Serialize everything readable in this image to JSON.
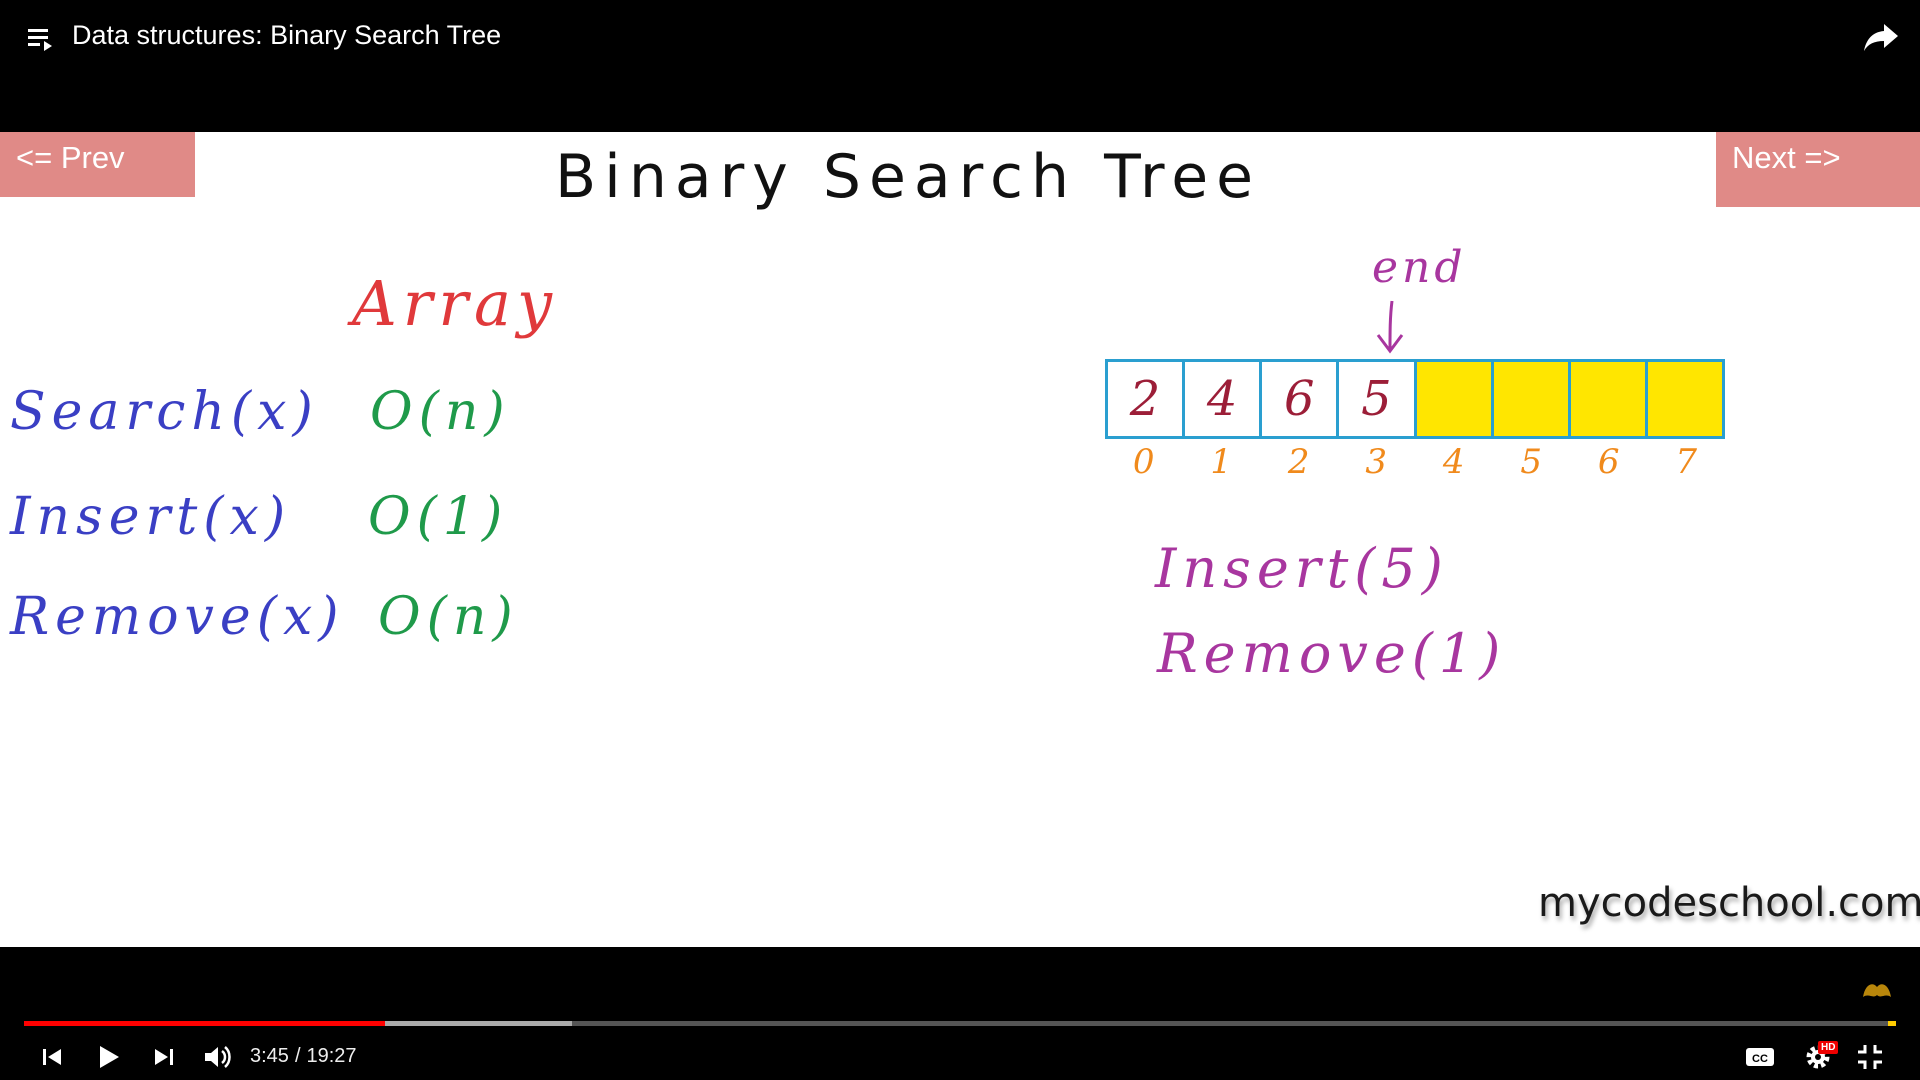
{
  "header": {
    "title": "Data structures: Binary Search Tree"
  },
  "slide": {
    "prev_label": "<= Prev",
    "next_label": "Next =>",
    "title": "Binary Search Tree",
    "array_heading": "Array",
    "operations": [
      {
        "label": "Search(x)",
        "cost": "O(n)"
      },
      {
        "label": "Insert(x)",
        "cost": "O(1)"
      },
      {
        "label": "Remove(x)",
        "cost": "O(n)"
      }
    ],
    "end_label": "end",
    "array_cells": [
      "2",
      "4",
      "6",
      "5",
      "",
      "",
      "",
      ""
    ],
    "array_indices": [
      "0",
      "1",
      "2",
      "3",
      "4",
      "5",
      "6",
      "7"
    ],
    "insert_example": "Insert(5)",
    "remove_example": "Remove(1)",
    "watermark": "mycodeschool.com",
    "colors": {
      "title": "#111111",
      "array_heading": "#e0393b",
      "operations": "#3a3fc4",
      "costs": "#1f9a4a",
      "examples": "#a8369f",
      "indices": "#f08a1c",
      "cell_values": "#9c1e38",
      "empty_cells": "#ffe600",
      "nav_buttons": "#e08a87"
    }
  },
  "controls": {
    "current_time": "3:45",
    "separator": "/",
    "duration": "19:27",
    "progress_played_fraction": 0.1928,
    "buffered_fraction": 0.2927,
    "icons": {
      "prev": "skip-previous-icon",
      "play": "play-icon",
      "next": "skip-next-icon",
      "volume": "volume-icon",
      "cc": "closed-captions-icon",
      "settings": "gear-icon",
      "fullscreen": "exit-fullscreen-icon",
      "share": "share-icon",
      "playlist": "playlist-icon"
    },
    "hd_badge": "HD",
    "cc_label": "CC"
  }
}
